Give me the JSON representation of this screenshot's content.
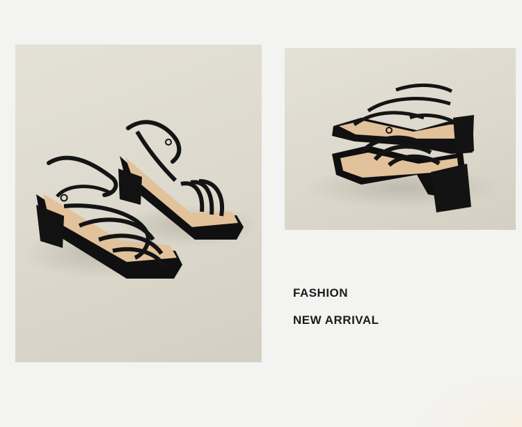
{
  "captions": {
    "line1": "FASHION",
    "line2": "NEW ARRIVAL"
  },
  "colors": {
    "background": "#f3f3f2",
    "backdrop": "#dcd8cc",
    "sandal": "#141414",
    "insole": "#e2c29a"
  }
}
